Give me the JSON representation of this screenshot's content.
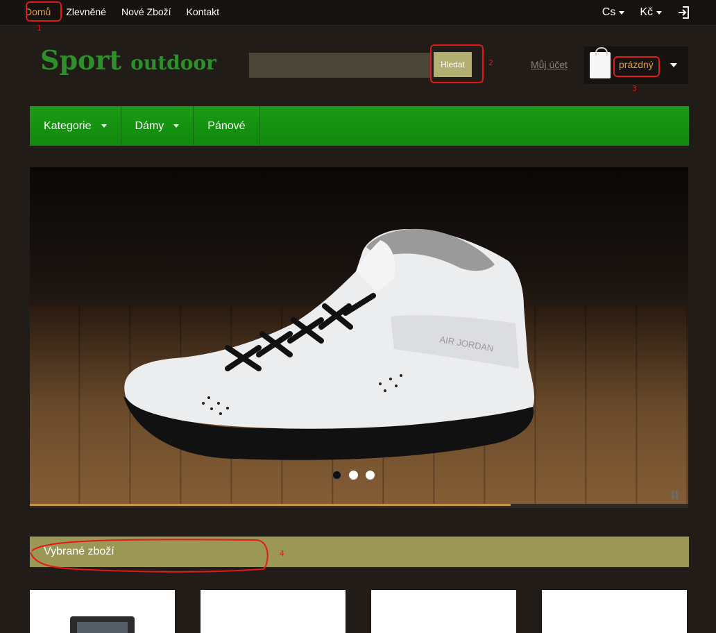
{
  "topnav": {
    "items": [
      {
        "label": "Domů",
        "active": true
      },
      {
        "label": "Zlevněné",
        "active": false
      },
      {
        "label": "Nové Zboží",
        "active": false
      },
      {
        "label": "Kontakt",
        "active": false
      }
    ],
    "language": "Cs",
    "currency": "Kč"
  },
  "header": {
    "logo_main": "Sport",
    "logo_sub": "outdoor",
    "search_placeholder": "",
    "search_button": "Hledat",
    "account_link": "Můj účet",
    "cart_label": "prázdný"
  },
  "mainnav": {
    "items": [
      {
        "label": "Kategorie",
        "has_dropdown": true
      },
      {
        "label": "Dámy",
        "has_dropdown": true
      },
      {
        "label": "Pánové",
        "has_dropdown": false
      }
    ]
  },
  "slider": {
    "slide_count": 3,
    "active_slide": 1,
    "progress_percent": 73,
    "image_subject": "white basketball sneaker on wooden floor",
    "shoe_text": "AIR JORDAN"
  },
  "section": {
    "title": "Vybrané zboží"
  },
  "annotations": [
    "1",
    "2",
    "3",
    "4"
  ],
  "colors": {
    "background": "#211c18",
    "topbar": "#151210",
    "accent_orange": "#e89a3a",
    "nav_green": "#16930f",
    "logo_green": "#2f8f2a",
    "section_olive": "#9a9854",
    "search_button": "#b3ae72",
    "annotation_red": "#e31818"
  }
}
